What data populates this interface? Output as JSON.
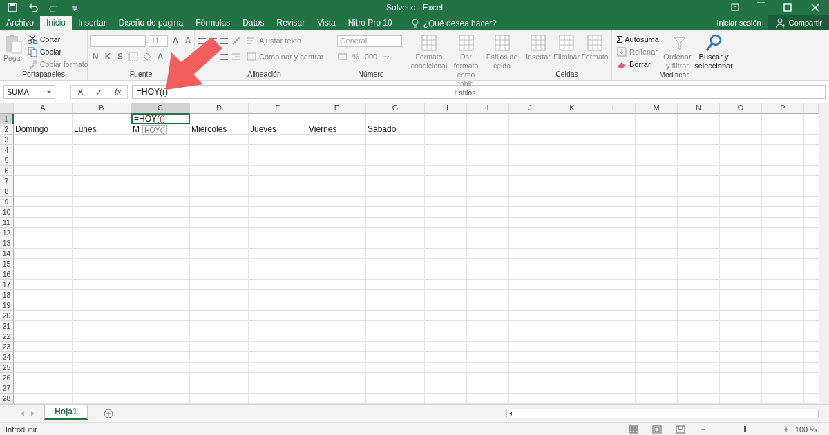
{
  "title_bar": {
    "title": "Solvetic - Excel"
  },
  "menu_tabs": [
    {
      "label": "Archivo",
      "selected": false
    },
    {
      "label": "Inicio",
      "selected": true
    },
    {
      "label": "Insertar",
      "selected": false
    },
    {
      "label": "Diseño de página",
      "selected": false
    },
    {
      "label": "Fórmulas",
      "selected": false
    },
    {
      "label": "Datos",
      "selected": false
    },
    {
      "label": "Revisar",
      "selected": false
    },
    {
      "label": "Vista",
      "selected": false
    },
    {
      "label": "Nitro Pro 10",
      "selected": false
    }
  ],
  "tell_me": {
    "placeholder": "¿Qué desea hacer?"
  },
  "account": {
    "sign_in": "Iniciar sesión",
    "share": "Compartir"
  },
  "ribbon": [
    {
      "kind": "clipboard",
      "label": "Portapapeles",
      "items": [
        {
          "label": "Pegar",
          "disabled": true
        },
        {
          "label": "Cortar",
          "disabled": false
        },
        {
          "label": "Copiar",
          "disabled": false
        },
        {
          "label": "Copiar formato",
          "disabled": true
        }
      ]
    },
    {
      "kind": "font",
      "label": "Fuente",
      "font_size": "11",
      "items": [
        {
          "label": "A",
          "disabled": true
        },
        {
          "label": "A",
          "disabled": true
        },
        {
          "label": "N",
          "disabled": true
        },
        {
          "label": "K",
          "disabled": true
        },
        {
          "label": "S",
          "disabled": true
        },
        {
          "label": "A",
          "disabled": true
        }
      ]
    },
    {
      "kind": "alignment",
      "label": "Alineación",
      "items": [
        {
          "label": "Ajustar texto",
          "disabled": true
        },
        {
          "label": "Combinar y centrar",
          "disabled": true
        }
      ]
    },
    {
      "kind": "number",
      "label": "Número",
      "format": "General",
      "items": [
        {
          "label": "%",
          "disabled": true
        },
        {
          "label": "000",
          "disabled": true
        }
      ]
    },
    {
      "kind": "large",
      "label": "Estilos",
      "items": [
        {
          "label": "Formato condicional",
          "disabled": true
        },
        {
          "label": "Dar formato como tabla",
          "disabled": true
        },
        {
          "label": "Estilos de celda",
          "disabled": true
        }
      ]
    },
    {
      "kind": "large",
      "label": "Celdas",
      "items": [
        {
          "label": "Insertar",
          "disabled": true
        },
        {
          "label": "Eliminar",
          "disabled": true
        },
        {
          "label": "Formato",
          "disabled": true
        }
      ]
    },
    {
      "kind": "editing",
      "label": "Modificar",
      "items": [
        {
          "label": "Autosuma",
          "icon": "Σ",
          "disabled": false
        },
        {
          "label": "Rellenar",
          "disabled": true
        },
        {
          "label": "Borrar",
          "disabled": false
        },
        {
          "label": "Ordenar y filtrar",
          "disabled": true
        },
        {
          "label": "Buscar y seleccionar",
          "disabled": false
        }
      ]
    }
  ],
  "formula_bar": {
    "name_box": "SUMA",
    "cancel": "✕",
    "enter": "✓",
    "function": "fx",
    "formula": "=HOY(()"
  },
  "columns": [
    {
      "label": "A",
      "selected": false
    },
    {
      "label": "B",
      "selected": false
    },
    {
      "label": "C",
      "selected": true
    },
    {
      "label": "D",
      "selected": false
    },
    {
      "label": "E",
      "selected": false
    },
    {
      "label": "F",
      "selected": false
    },
    {
      "label": "G",
      "selected": false
    },
    {
      "label": "H",
      "selected": false
    },
    {
      "label": "I",
      "selected": false
    },
    {
      "label": "J",
      "selected": false
    },
    {
      "label": "K",
      "selected": false
    },
    {
      "label": "L",
      "selected": false
    },
    {
      "label": "M",
      "selected": false
    },
    {
      "label": "N",
      "selected": false
    },
    {
      "label": "O",
      "selected": false
    },
    {
      "label": "P",
      "selected": false
    }
  ],
  "rows": [
    {
      "number": "1",
      "selected": true,
      "cells": [
        {
          "kind": "empty"
        },
        {
          "kind": "empty"
        },
        {
          "kind": "editing",
          "text": "=HOY(",
          "argument": "()",
          "tooltip": "HOY()"
        }
      ]
    },
    {
      "number": "2",
      "selected": false,
      "cells": [
        {
          "kind": "text",
          "text": "Domingo"
        },
        {
          "kind": "text",
          "text": "Lunes"
        },
        {
          "kind": "text",
          "text": "M"
        },
        {
          "kind": "text",
          "text": "Miércoles"
        },
        {
          "kind": "text",
          "text": "Jueves"
        },
        {
          "kind": "text",
          "text": "Viernes"
        },
        {
          "kind": "text",
          "text": "Sábado"
        }
      ]
    },
    {
      "number": "3",
      "selected": false
    },
    {
      "number": "4",
      "selected": false
    },
    {
      "number": "5",
      "selected": false
    },
    {
      "number": "6",
      "selected": false
    },
    {
      "number": "7",
      "selected": false
    },
    {
      "number": "8",
      "selected": false
    },
    {
      "number": "9",
      "selected": false
    },
    {
      "number": "10",
      "selected": false
    },
    {
      "number": "11",
      "selected": false
    },
    {
      "number": "12",
      "selected": false
    },
    {
      "number": "13",
      "selected": false
    },
    {
      "number": "14",
      "selected": false
    },
    {
      "number": "15",
      "selected": false
    },
    {
      "number": "16",
      "selected": false
    },
    {
      "number": "17",
      "selected": false
    },
    {
      "number": "18",
      "selected": false
    },
    {
      "number": "19",
      "selected": false
    },
    {
      "number": "20",
      "selected": false
    },
    {
      "number": "21",
      "selected": false
    },
    {
      "number": "22",
      "selected": false
    },
    {
      "number": "23",
      "selected": false
    },
    {
      "number": "24",
      "selected": false
    },
    {
      "number": "25",
      "selected": false
    },
    {
      "number": "26",
      "selected": false
    },
    {
      "number": "27",
      "selected": false
    },
    {
      "number": "28",
      "selected": false
    }
  ],
  "sheet_tabs": [
    {
      "label": "Hoja1",
      "selected": true
    }
  ],
  "status_bar": {
    "mode": "Introducir",
    "zoom": {
      "level": 0.5,
      "reading": "100 %"
    }
  },
  "annotation": {
    "kind": "arrow"
  }
}
